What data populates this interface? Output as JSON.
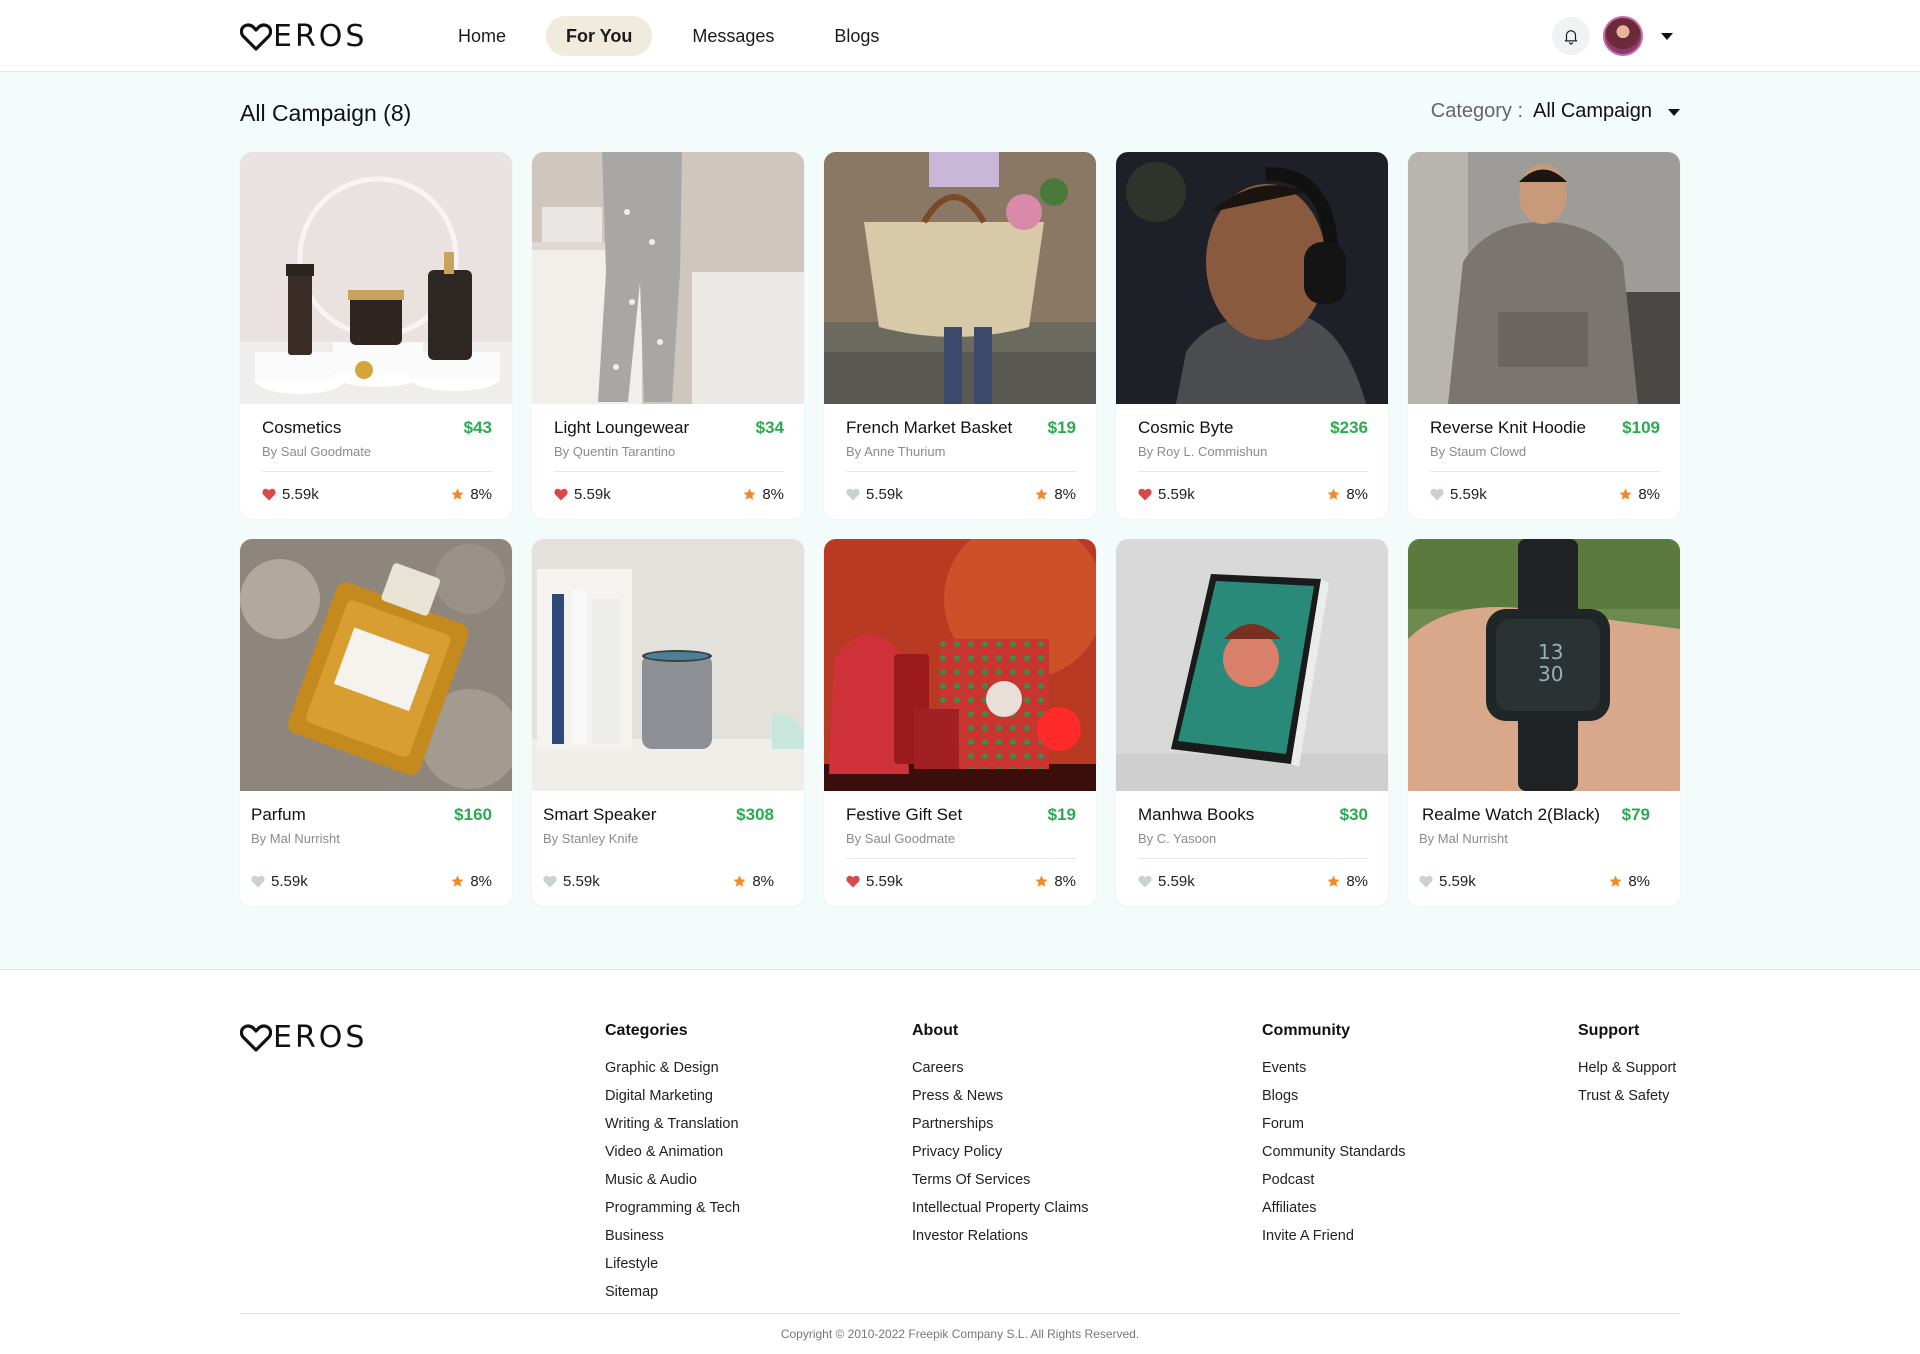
{
  "brand": {
    "name": "EROS"
  },
  "nav": {
    "items": [
      "Home",
      "For You",
      "Messages",
      "Blogs"
    ],
    "active": "For You"
  },
  "main": {
    "title": "All Campaign (8)",
    "category_label": "Category :",
    "category_value": "All Campaign"
  },
  "colors": {
    "price": "#2bab4f",
    "like_active": "#d84a4a",
    "like_inactive": "#c7d3d3",
    "star": "#f08a2a",
    "active_tab": "#f1ebde",
    "main_bg": "#f3fbfb"
  },
  "cards": [
    {
      "name": "Cosmetics",
      "price": "$43",
      "by": "By Saul Goodmate",
      "likes": "5.59k",
      "liked": true,
      "rating": "8%"
    },
    {
      "name": "Light Loungewear",
      "price": "$34",
      "by": "By Quentin Tarantino",
      "likes": "5.59k",
      "liked": true,
      "rating": "8%"
    },
    {
      "name": "French Market Basket",
      "price": "$19",
      "by": "By Anne Thurium",
      "likes": "5.59k",
      "liked": false,
      "rating": "8%"
    },
    {
      "name": "Cosmic Byte",
      "price": "$236",
      "by": "By Roy L. Commishun",
      "likes": "5.59k",
      "liked": true,
      "rating": "8%"
    },
    {
      "name": "Reverse Knit Hoodie",
      "price": "$109",
      "by": "By Staum Clowd",
      "likes": "5.59k",
      "liked": false,
      "rating": "8%"
    },
    {
      "name": "Parfum",
      "price": "$160",
      "by": "By Mal Nurrisht",
      "likes": "5.59k",
      "liked": false,
      "rating": "8%"
    },
    {
      "name": "Smart Speaker",
      "price": "$308",
      "by": "By Stanley Knife",
      "likes": "5.59k",
      "liked": false,
      "rating": "8%"
    },
    {
      "name": "Festive Gift Set",
      "price": "$19",
      "by": "By Saul Goodmate",
      "likes": "5.59k",
      "liked": true,
      "rating": "8%"
    },
    {
      "name": "Manhwa Books",
      "price": "$30",
      "by": "By C. Yasoon",
      "likes": "5.59k",
      "liked": false,
      "rating": "8%"
    },
    {
      "name": "Realme Watch 2(Black)",
      "price": "$79",
      "by": "By Mal Nurrisht",
      "likes": "5.59k",
      "liked": false,
      "rating": "8%"
    }
  ],
  "footer": {
    "categories": {
      "title": "Categories",
      "links": [
        "Graphic & Design",
        "Digital Marketing",
        "Writing & Translation",
        "Video & Animation",
        "Music & Audio",
        "Programming & Tech",
        "Business",
        "Lifestyle",
        "Sitemap"
      ]
    },
    "about": {
      "title": "About",
      "links": [
        "Careers",
        "Press & News",
        "Partnerships",
        "Privacy Policy",
        "Terms Of Services",
        "Intellectual Property Claims",
        "Investor Relations"
      ]
    },
    "community": {
      "title": "Community",
      "links": [
        "Events",
        "Blogs",
        "Forum",
        "Community Standards",
        "Podcast",
        "Affiliates",
        "Invite A Friend"
      ]
    },
    "support": {
      "title": "Support",
      "links": [
        "Help & Support",
        "Trust & Safety"
      ]
    },
    "copyright": "Copyright ©  2010-2022 Freepik Company S.L. All Rights Reserved."
  }
}
